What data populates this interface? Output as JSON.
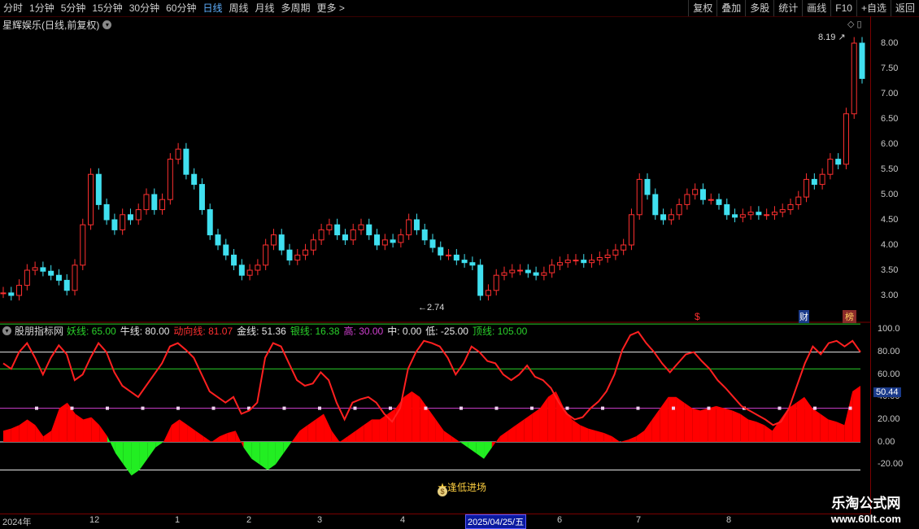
{
  "toolbar": {
    "periods": [
      "分时",
      "1分钟",
      "5分钟",
      "15分钟",
      "30分钟",
      "60分钟",
      "日线",
      "周线",
      "月线",
      "多周期",
      "更多 >"
    ],
    "active_period": "日线",
    "buttons": [
      "复权",
      "叠加",
      "多股",
      "统计",
      "画线",
      "F10",
      "+自选",
      "返回"
    ]
  },
  "stock": {
    "title": "星辉娱乐(日线,前复权)"
  },
  "price_axis": [
    "8.00",
    "7.50",
    "7.00",
    "6.50",
    "6.00",
    "5.50",
    "5.00",
    "4.50",
    "4.00",
    "3.50",
    "3.00"
  ],
  "price_annotations": {
    "high": "8.19",
    "low": "2.74"
  },
  "event_markers": [
    "$",
    "财",
    "榜"
  ],
  "indicator": {
    "name": "股朋指标网",
    "items": [
      {
        "label": "妖线:",
        "value": "65.00",
        "color": "#2ad12a"
      },
      {
        "label": "牛线:",
        "value": "80.00",
        "color": "#e8e8e8"
      },
      {
        "label": "动向线:",
        "value": "81.07",
        "color": "#ff3030"
      },
      {
        "label": "金线:",
        "value": "51.36",
        "color": "#e8e8e8"
      },
      {
        "label": "银线:",
        "value": "16.38",
        "color": "#2ad12a"
      },
      {
        "label": "高:",
        "value": "30.00",
        "color": "#d040d0"
      },
      {
        "label": "中:",
        "value": "0.00",
        "color": "#e8e8e8"
      },
      {
        "label": "低:",
        "value": "-25.00",
        "color": "#e8e8e8"
      },
      {
        "label": "顶线:",
        "value": "105.00",
        "color": "#2ad12a"
      }
    ],
    "signal_text": "逢低进场",
    "current_value": "50.44"
  },
  "indicator_axis": [
    "100.0",
    "80.00",
    "60.00",
    "40.00",
    "20.00",
    "0.00",
    "-20.00"
  ],
  "time_axis": [
    "2024年",
    "12",
    "1",
    "2",
    "3",
    "4",
    "5",
    "6",
    "7",
    "8"
  ],
  "selected_date": "2025/04/25/五",
  "watermark": {
    "name": "乐淘公式网",
    "url": "www.60lt.com"
  },
  "colors": {
    "up": "#ff3030",
    "down": "#40e0f0",
    "bull": "#ff0000",
    "bear": "#22ee22",
    "purple": "#d040d0",
    "grid_red": "#7a0000"
  },
  "chart_data": {
    "type": "candlestick",
    "price_close": [
      3.05,
      3.0,
      3.2,
      3.5,
      3.55,
      3.48,
      3.4,
      3.3,
      3.1,
      3.6,
      4.4,
      5.4,
      4.8,
      4.5,
      4.3,
      4.6,
      4.5,
      4.7,
      5.0,
      4.7,
      4.9,
      5.7,
      5.9,
      5.4,
      5.2,
      4.7,
      4.2,
      4.0,
      3.8,
      3.6,
      3.4,
      3.5,
      3.6,
      4.0,
      4.2,
      3.9,
      3.7,
      3.8,
      3.9,
      4.1,
      4.3,
      4.4,
      4.2,
      4.1,
      4.3,
      4.4,
      4.2,
      4.0,
      4.1,
      4.05,
      4.2,
      4.5,
      4.3,
      4.1,
      3.95,
      3.8,
      3.8,
      3.7,
      3.65,
      3.6,
      3.0,
      3.1,
      3.4,
      3.45,
      3.5,
      3.5,
      3.45,
      3.4,
      3.45,
      3.6,
      3.65,
      3.7,
      3.7,
      3.65,
      3.7,
      3.75,
      3.8,
      3.9,
      4.0,
      4.6,
      5.3,
      5.0,
      4.6,
      4.5,
      4.6,
      4.8,
      5.0,
      5.1,
      4.9,
      4.9,
      4.8,
      4.6,
      4.55,
      4.6,
      4.65,
      4.6,
      4.6,
      4.65,
      4.7,
      4.8,
      4.95,
      5.3,
      5.2,
      5.4,
      5.7,
      5.6,
      6.6,
      8.0,
      7.3
    ],
    "indicator_series": [
      {
        "name": "动向线",
        "values": [
          70,
          65,
          80,
          88,
          75,
          60,
          75,
          86,
          78,
          55,
          60,
          75,
          88,
          80,
          62,
          50,
          45,
          40,
          50,
          60,
          70,
          85,
          88,
          82,
          75,
          60,
          45,
          40,
          35,
          40,
          25,
          28,
          35,
          75,
          88,
          85,
          70,
          55,
          50,
          52,
          62,
          55,
          35,
          20,
          35,
          38,
          40,
          35,
          25,
          18,
          30,
          65,
          80,
          90,
          88,
          85,
          75,
          60,
          70,
          85,
          80,
          72,
          70,
          60,
          55,
          60,
          68,
          58,
          55,
          48,
          35,
          25,
          20,
          22,
          30,
          36,
          45,
          60,
          82,
          95,
          98,
          88,
          80,
          70,
          62,
          70,
          78,
          80,
          72,
          65,
          55,
          48,
          40,
          32,
          28,
          24,
          20,
          15,
          18,
          30,
          50,
          70,
          85,
          78,
          88,
          90,
          85,
          90,
          80
        ]
      },
      {
        "name": "金线",
        "values": [
          10,
          12,
          15,
          20,
          15,
          5,
          10,
          30,
          35,
          25,
          20,
          22,
          15,
          5,
          -10,
          -20,
          -30,
          -25,
          -15,
          -5,
          0,
          15,
          20,
          15,
          10,
          5,
          0,
          5,
          8,
          10,
          -5,
          -15,
          -20,
          -25,
          -20,
          -10,
          0,
          10,
          15,
          20,
          25,
          10,
          0,
          5,
          10,
          15,
          20,
          20,
          25,
          30,
          40,
          45,
          40,
          30,
          20,
          10,
          5,
          0,
          -5,
          -10,
          -15,
          -5,
          5,
          10,
          15,
          20,
          25,
          30,
          40,
          45,
          30,
          20,
          15,
          12,
          10,
          8,
          5,
          0,
          2,
          5,
          10,
          20,
          30,
          40,
          40,
          35,
          30,
          28,
          30,
          32,
          30,
          28,
          25,
          20,
          18,
          15,
          10,
          20,
          30,
          35,
          40,
          30,
          25,
          20,
          18,
          15,
          45,
          50
        ]
      }
    ]
  }
}
